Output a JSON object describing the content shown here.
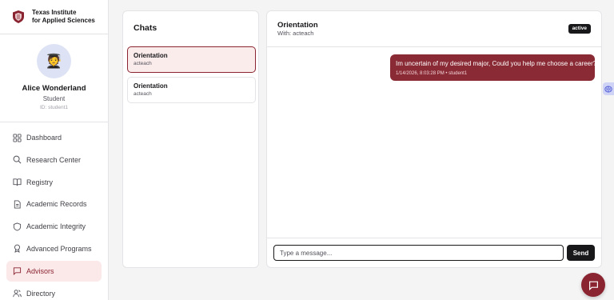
{
  "brand": {
    "line1": "Texas Institute",
    "line2": "for Applied Sciences"
  },
  "profile": {
    "name": "Alice Wonderland",
    "role": "Student",
    "id_text": "ID: student1",
    "avatar_emoji": "🧑‍🎓"
  },
  "nav": {
    "items": [
      {
        "label": "Dashboard",
        "icon": "grid-icon"
      },
      {
        "label": "Research Center",
        "icon": "search-icon"
      },
      {
        "label": "Registry",
        "icon": "book-icon"
      },
      {
        "label": "Academic Records",
        "icon": "document-icon"
      },
      {
        "label": "Academic Integrity",
        "icon": "shield-icon"
      },
      {
        "label": "Advanced Programs",
        "icon": "award-icon"
      },
      {
        "label": "Advisors",
        "icon": "message-icon",
        "active": true
      },
      {
        "label": "Directory",
        "icon": "users-icon"
      }
    ]
  },
  "chats": {
    "title": "Chats",
    "items": [
      {
        "title": "Orientation",
        "subtitle": "acteach",
        "selected": true
      },
      {
        "title": "Orientation",
        "subtitle": "acteach",
        "selected": false
      }
    ]
  },
  "conversation": {
    "title": "Orientation",
    "with_text": "With: acteach",
    "status": "active",
    "messages": [
      {
        "text": "Im uncertain of my desired major, Could you help me choose a career?",
        "meta": "1/14/2026, 8:03:28 PM • student1"
      }
    ]
  },
  "composer": {
    "placeholder": "Type a message...",
    "send_label": "Send"
  },
  "colors": {
    "accent": "#8a2430",
    "bubble": "#8a2a35",
    "dark": "#18181b",
    "active_bg": "#fbe9ea"
  }
}
